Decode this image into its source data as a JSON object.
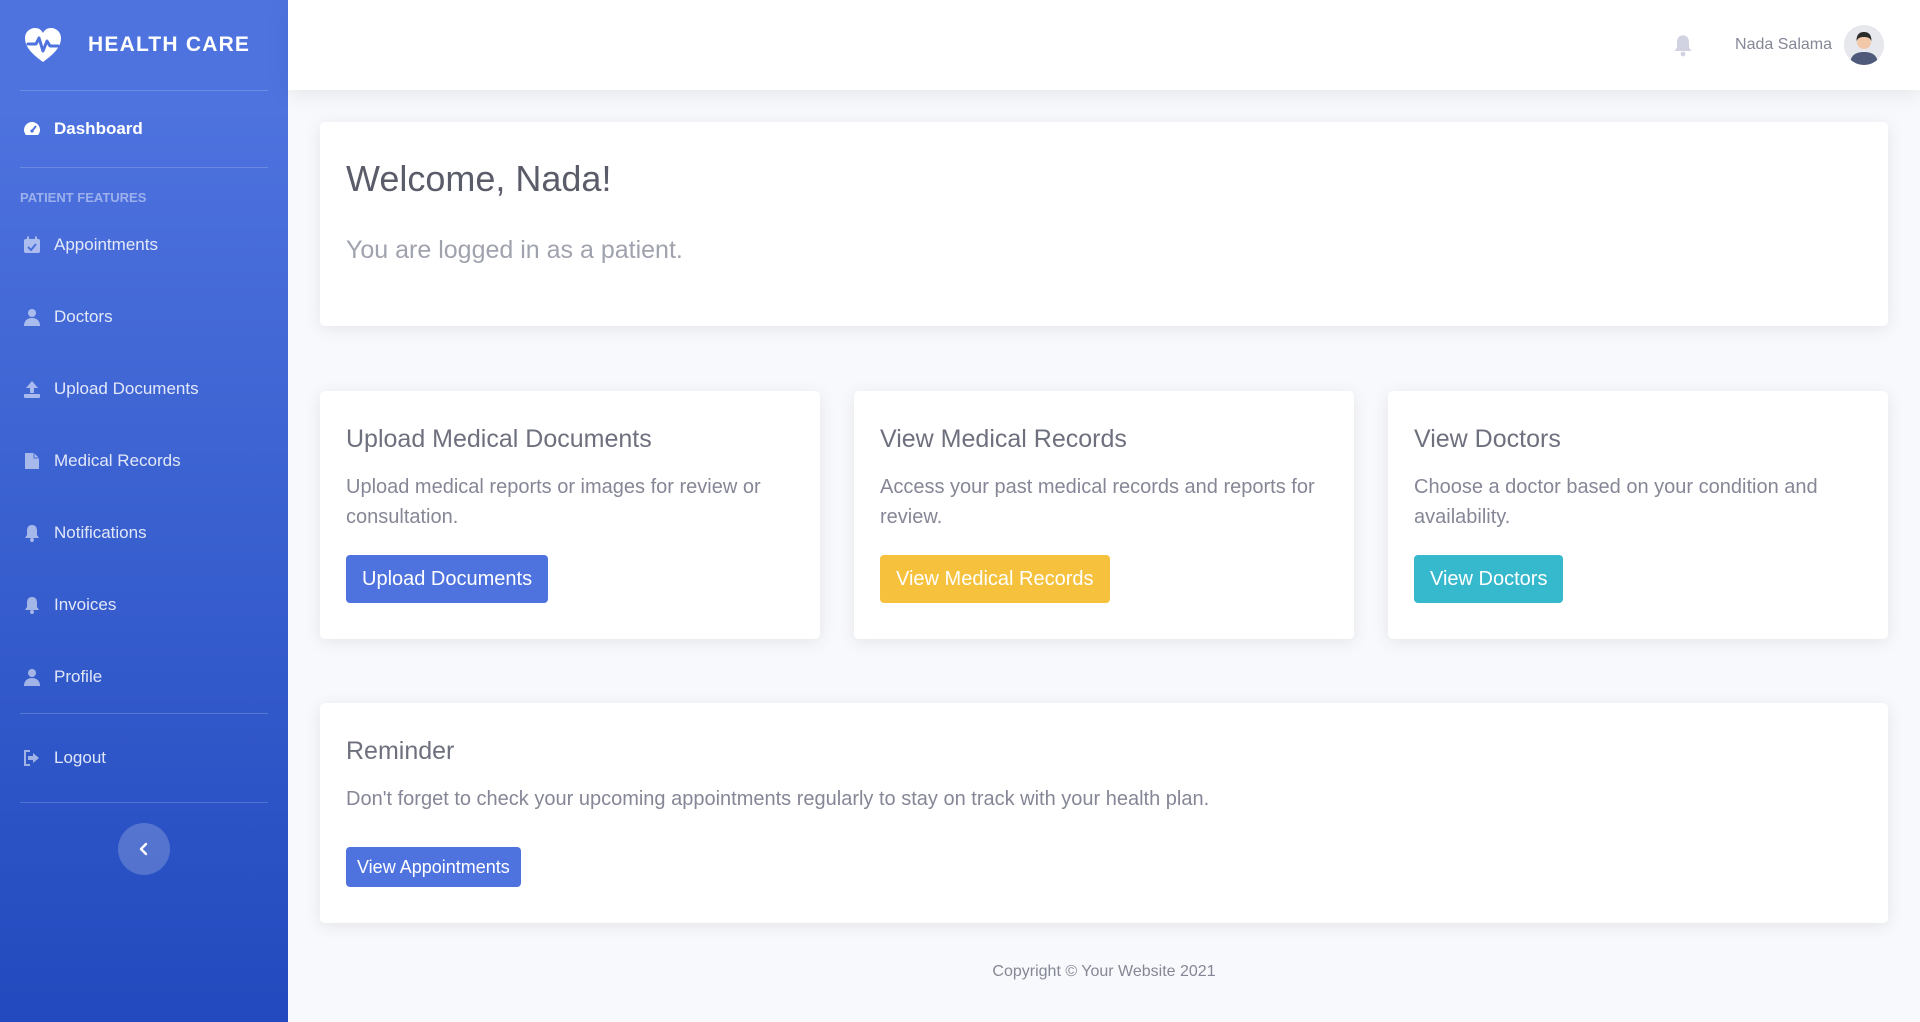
{
  "brand": {
    "name": "HEALTH CARE",
    "logo_icon": "heart-pulse-icon"
  },
  "sidebar": {
    "dashboard": {
      "label": "Dashboard",
      "icon": "tachometer-icon"
    },
    "heading": "PATIENT FEATURES",
    "items": [
      {
        "label": "Appointments",
        "icon": "calendar-icon"
      },
      {
        "label": "Doctors",
        "icon": "user-md-icon"
      },
      {
        "label": "Upload Documents",
        "icon": "upload-icon"
      },
      {
        "label": "Medical Records",
        "icon": "file-medical-icon"
      },
      {
        "label": "Notifications",
        "icon": "bell-icon"
      },
      {
        "label": "Invoices",
        "icon": "bell-icon"
      },
      {
        "label": "Profile",
        "icon": "user-icon"
      }
    ],
    "logout": {
      "label": "Logout",
      "icon": "sign-out-icon"
    }
  },
  "topbar": {
    "user_name": "Nada Salama"
  },
  "welcome": {
    "title": "Welcome, Nada!",
    "subtitle": "You are logged in as a patient."
  },
  "cards": [
    {
      "title": "Upload Medical Documents",
      "text": "Upload medical reports or images for review or consultation.",
      "button": "Upload Documents"
    },
    {
      "title": "View Medical Records",
      "text": "Access your past medical records and reports for review.",
      "button": "View Medical Records"
    },
    {
      "title": "View Doctors",
      "text": "Choose a doctor based on your condition and availability.",
      "button": "View Doctors"
    }
  ],
  "reminder": {
    "title": "Reminder",
    "text": "Don't forget to check your upcoming appointments regularly to stay on track with your health plan.",
    "button": "View Appointments"
  },
  "footer": {
    "copyright": "Copyright © Your Website 2021"
  },
  "colors": {
    "primary": "#4e73df",
    "warning": "#f6c23e",
    "info": "#36b9cc",
    "sidebar_dark": "#224abe"
  }
}
